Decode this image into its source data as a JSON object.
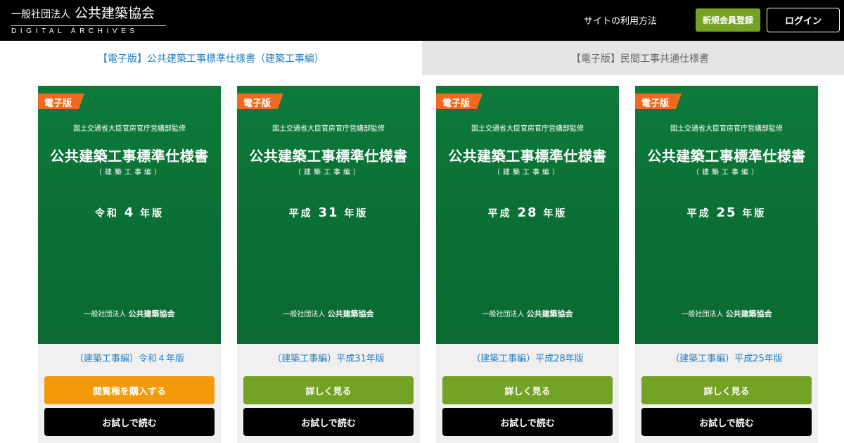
{
  "header": {
    "logo": {
      "org_prefix": "一般社団法人",
      "org_name": "公共建築協会",
      "subtitle": "DIGITAL ARCHIVES"
    },
    "nav_link": "サイトの利用方法",
    "register_label": "新規会員登録",
    "login_label": "ログイン",
    "colors": {
      "register_bg": "#74a224",
      "header_bg": "#000000"
    }
  },
  "tabs": [
    {
      "label": "【電子版】公共建築工事標準仕様書（建築工事編）",
      "active": true
    },
    {
      "label": "【電子版】民間工事共通仕様書",
      "active": false
    }
  ],
  "cards": [
    {
      "badge": "電子版",
      "supervise": "国土交通省大臣官房官庁営繕部監修",
      "title": "公共建築工事標準仕様書",
      "subtitle": "（建築工事編）",
      "era": "令和",
      "year": "4",
      "edition_suffix": "年版",
      "publisher_prefix": "一般社団法人",
      "publisher_name": "公共建築協会",
      "caption": "（建築工事編）令和４年版",
      "primary_label": "閲覧権を購入する",
      "primary_color": "#f39a0a",
      "trial_label": "お試しで読む"
    },
    {
      "badge": "電子版",
      "supervise": "国土交通省大臣官房官庁営繕部監修",
      "title": "公共建築工事標準仕様書",
      "subtitle": "（建築工事編）",
      "era": "平成",
      "year": "31",
      "edition_suffix": "年版",
      "publisher_prefix": "一般社団法人",
      "publisher_name": "公共建築協会",
      "caption": "（建築工事編）平成31年版",
      "primary_label": "詳しく見る",
      "primary_color": "#74a224",
      "trial_label": "お試しで読む"
    },
    {
      "badge": "電子版",
      "supervise": "国土交通省大臣官房官庁営繕部監修",
      "title": "公共建築工事標準仕様書",
      "subtitle": "（建築工事編）",
      "era": "平成",
      "year": "28",
      "edition_suffix": "年版",
      "publisher_prefix": "一般社団法人",
      "publisher_name": "公共建築協会",
      "caption": "（建築工事編）平成28年版",
      "primary_label": "詳しく見る",
      "primary_color": "#74a224",
      "trial_label": "お試しで読む"
    },
    {
      "badge": "電子版",
      "supervise": "国土交通省大臣官房官庁営繕部監修",
      "title": "公共建築工事標準仕様書",
      "subtitle": "（建築工事編）",
      "era": "平成",
      "year": "25",
      "edition_suffix": "年版",
      "publisher_prefix": "一般社団法人",
      "publisher_name": "公共建築協会",
      "caption": "（建築工事編）平成25年版",
      "primary_label": "詳しく見る",
      "primary_color": "#74a224",
      "trial_label": "お試しで読む"
    }
  ],
  "colors": {
    "cover_green": "#0b6f35",
    "badge_orange": "#ee6a1f",
    "link_blue": "#1f7fc4",
    "tab_inactive_bg": "#e5e5e5"
  }
}
